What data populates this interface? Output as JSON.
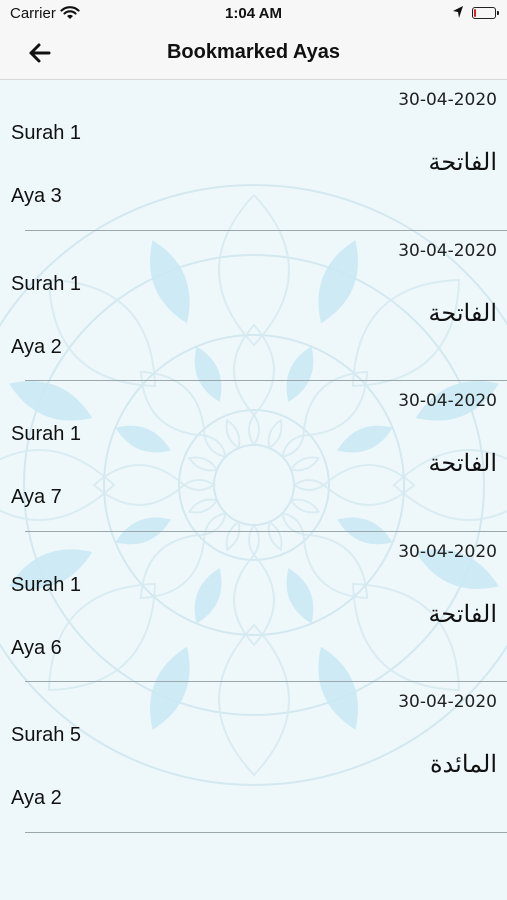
{
  "status_bar": {
    "carrier": "Carrier",
    "time": "1:04 AM",
    "battery_level_percent": 10,
    "battery_color": "#dd2222"
  },
  "nav": {
    "title": "Bookmarked Ayas",
    "back_icon": "arrow-left-icon"
  },
  "bookmarks": [
    {
      "date": "30-04-2020",
      "surah": "Surah 1",
      "surah_name": "الفاتحة",
      "aya": "Aya 3"
    },
    {
      "date": "30-04-2020",
      "surah": "Surah 1",
      "surah_name": "الفاتحة",
      "aya": "Aya 2"
    },
    {
      "date": "30-04-2020",
      "surah": "Surah 1",
      "surah_name": "الفاتحة",
      "aya": "Aya 7"
    },
    {
      "date": "30-04-2020",
      "surah": "Surah 1",
      "surah_name": "الفاتحة",
      "aya": "Aya 6"
    },
    {
      "date": "30-04-2020",
      "surah": "Surah 5",
      "surah_name": "المائدة",
      "aya": "Aya 2"
    }
  ],
  "colors": {
    "background": "#eef8fb",
    "mandala_fill": "#c8e9f3",
    "mandala_stroke": "#d6eaf0",
    "separator": "#9aa7ab"
  }
}
